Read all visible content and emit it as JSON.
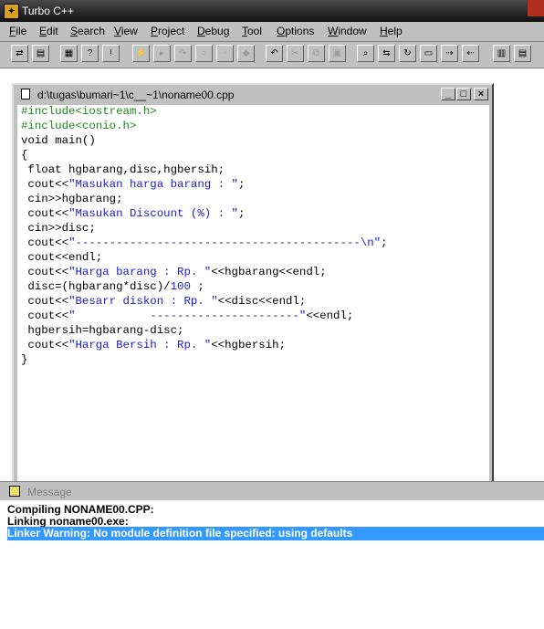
{
  "app": {
    "title": "Turbo C++",
    "icon": "turbo-cpp-icon"
  },
  "menu": [
    "File",
    "Edit",
    "Search",
    "View",
    "Project",
    "Debug",
    "Tool",
    "Options",
    "Window",
    "Help"
  ],
  "toolbar": {
    "icons": [
      "open-project-icon",
      "save-icon",
      "compile-icon",
      "help-icon",
      "info-icon",
      "lightning-icon",
      "step-over-icon",
      "trace-icon",
      "run-icon",
      "paste-icon",
      "breakpoint-icon",
      "undo-icon",
      "cut-icon",
      "copy-icon",
      "paste-clipboard-icon",
      "search-icon",
      "replace-icon",
      "search-again-icon",
      "browse-icon",
      "next-icon",
      "previous-icon",
      "tile-icon",
      "cascade-icon"
    ]
  },
  "editor": {
    "path": "d:\\tugas\\bumari~1\\c__~1\\noname00.cpp",
    "minimize": "_",
    "maximize": "□",
    "close": "×",
    "lines": [
      {
        "segs": [
          {
            "t": "#include<iostream.h>",
            "c": "pre"
          }
        ]
      },
      {
        "segs": [
          {
            "t": "#include<conio.h>",
            "c": "pre"
          }
        ]
      },
      {
        "segs": [
          {
            "t": "void main()",
            "c": ""
          }
        ]
      },
      {
        "segs": [
          {
            "t": "{",
            "c": ""
          }
        ]
      },
      {
        "segs": [
          {
            "t": " float hgbarang,disc,hgbersih;",
            "c": ""
          }
        ]
      },
      {
        "segs": [
          {
            "t": " cout<<",
            "c": ""
          },
          {
            "t": "\"Masukan harga barang : \"",
            "c": "str"
          },
          {
            "t": ";",
            "c": ""
          }
        ]
      },
      {
        "segs": [
          {
            "t": " cin>>hgbarang;",
            "c": ""
          }
        ]
      },
      {
        "segs": [
          {
            "t": " cout<<",
            "c": ""
          },
          {
            "t": "\"Masukan Discount (%) : \"",
            "c": "str"
          },
          {
            "t": ";",
            "c": ""
          }
        ]
      },
      {
        "segs": [
          {
            "t": " cin>>disc;",
            "c": ""
          }
        ]
      },
      {
        "segs": [
          {
            "t": " cout<<",
            "c": ""
          },
          {
            "t": "\"------------------------------------------\\n\"",
            "c": "str"
          },
          {
            "t": ";",
            "c": ""
          }
        ]
      },
      {
        "segs": [
          {
            "t": " cout<<endl;",
            "c": ""
          }
        ]
      },
      {
        "segs": [
          {
            "t": " cout<<",
            "c": ""
          },
          {
            "t": "\"Harga barang : Rp. \"",
            "c": "str"
          },
          {
            "t": "<<hgbarang<<endl;",
            "c": ""
          }
        ]
      },
      {
        "segs": [
          {
            "t": " disc=(hgbarang*disc)/",
            "c": ""
          },
          {
            "t": "100",
            "c": "str"
          },
          {
            "t": " ;",
            "c": ""
          }
        ]
      },
      {
        "segs": [
          {
            "t": " cout<<",
            "c": ""
          },
          {
            "t": "\"Besarr diskon : Rp. \"",
            "c": "str"
          },
          {
            "t": "<<disc<<endl;",
            "c": ""
          }
        ]
      },
      {
        "segs": [
          {
            "t": " cout<<",
            "c": ""
          },
          {
            "t": "\"           ----------------------\"",
            "c": "str"
          },
          {
            "t": "<<endl;",
            "c": ""
          }
        ]
      },
      {
        "segs": [
          {
            "t": " hgbersih=hgbarang-disc;",
            "c": ""
          }
        ]
      },
      {
        "segs": [
          {
            "t": " cout<<",
            "c": ""
          },
          {
            "t": "\"Harga Bersih : Rp. \"",
            "c": "str"
          },
          {
            "t": "<<hgbersih;",
            "c": ""
          }
        ]
      },
      {
        "segs": [
          {
            "t": "}",
            "c": ""
          }
        ]
      }
    ]
  },
  "messages": {
    "title": "Message",
    "lines": [
      {
        "text": "Compiling NONAME00.CPP:",
        "selected": false
      },
      {
        "text": "Linking noname00.exe:",
        "selected": false
      },
      {
        "text": "Linker Warning: No module definition file specified: using defaults",
        "selected": true
      }
    ]
  },
  "colors": {
    "string": "#1a1ad0",
    "preprocessor": "#1a8a1a",
    "selection": "#3399ff",
    "chrome": "#c0c0c0"
  }
}
